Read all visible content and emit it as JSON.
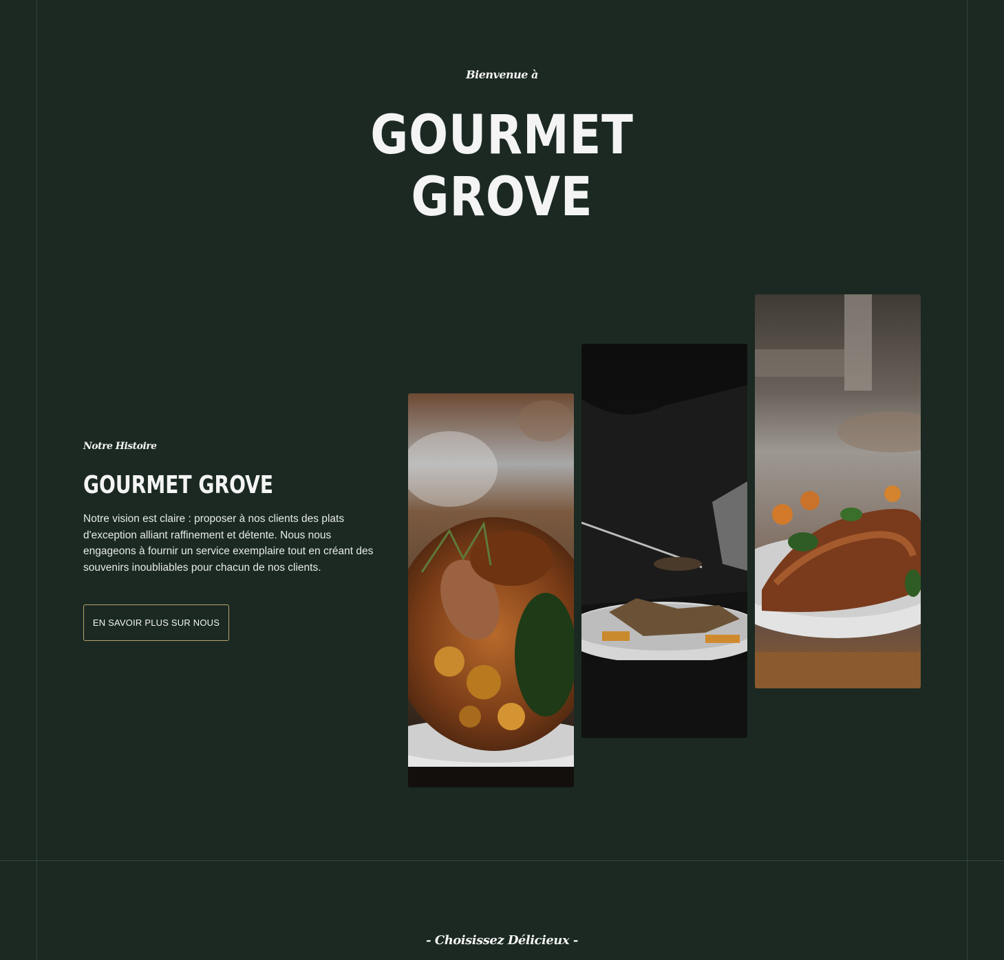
{
  "hero": {
    "welcome": "Bienvenue à",
    "title_line1": "GOURMET",
    "title_line2": "GROVE"
  },
  "story": {
    "kicker": "Notre Histoire",
    "title": "GOURMET GROVE",
    "text": "Notre vision est claire : proposer à nos clients des plats d'exception alliant raffinement et détente. Nous nous engageons à fournir un service exemplaire tout en créant des souvenirs inoubliables pour chacun de nos clients.",
    "button_label": "EN SAVOIR PLUS SUR NOUS"
  },
  "gallery": {
    "images": [
      "roasted-dish-photo",
      "chef-plating-photo",
      "glazed-meat-plate-photo"
    ]
  },
  "menu_section": {
    "heading": "- Choisissez Délicieux -"
  },
  "colors": {
    "background": "#1b2922",
    "button_border": "#b8a56a",
    "text": "#f4f4f4"
  }
}
